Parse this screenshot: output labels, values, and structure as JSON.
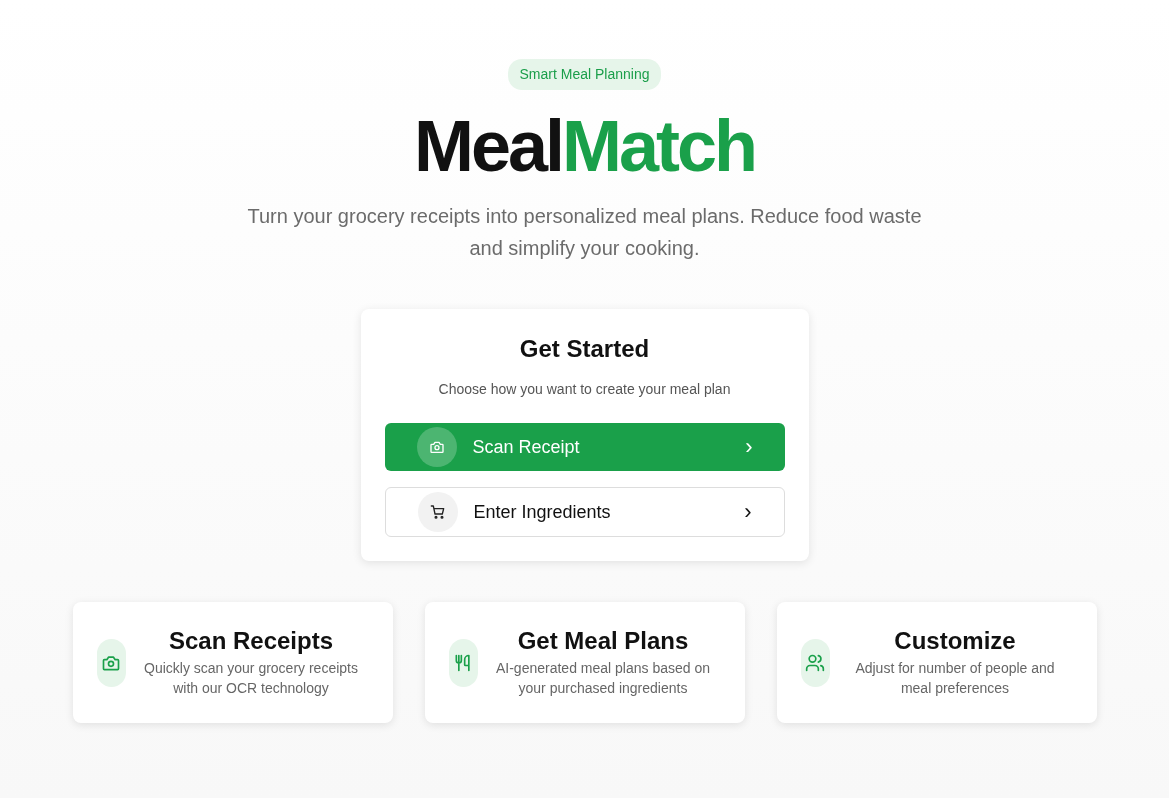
{
  "badge": "Smart Meal Planning",
  "title": {
    "part_1": "Meal",
    "part_2": "Match"
  },
  "subtitle": "Turn your grocery receipts into personalized meal plans. Reduce food waste and simplify your cooking.",
  "start_card": {
    "title": "Get Started",
    "description": "Choose how you want to create your meal plan",
    "options": [
      {
        "label": "Scan Receipt",
        "kind": "primary",
        "arrow": "›"
      },
      {
        "label": "Enter Ingredients",
        "kind": "outline",
        "arrow": "›"
      }
    ]
  },
  "features": [
    {
      "title": "Scan Receipts",
      "description": "Quickly scan your grocery receipts with our OCR technology"
    },
    {
      "title": "Get Meal Plans",
      "description": "AI-generated meal plans based on your purchased ingredients"
    },
    {
      "title": "Customize",
      "description": "Adjust for number of people and meal preferences"
    }
  ]
}
